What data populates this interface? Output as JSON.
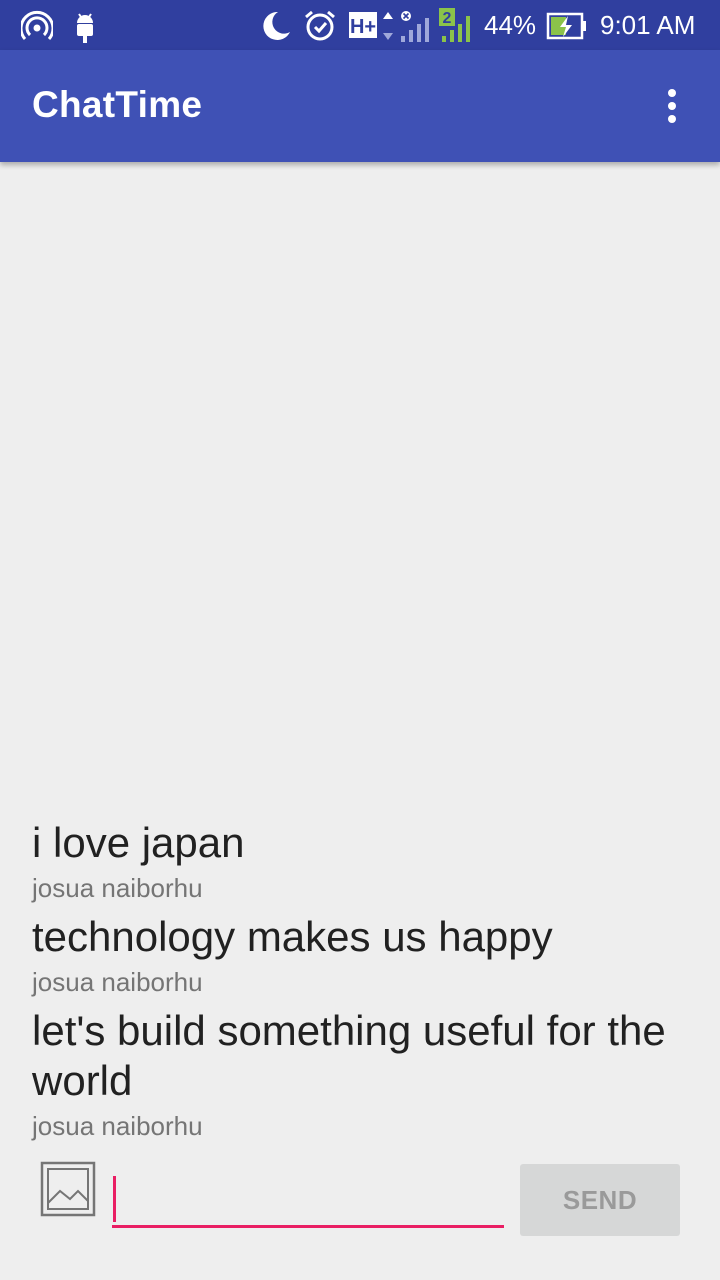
{
  "status_bar": {
    "icons": [
      "hotspot-icon",
      "android-debug-icon",
      "do-not-disturb-moon-icon",
      "alarm-icon",
      "network-h-plus-icon",
      "signal-icon",
      "sim-2-signal-icon",
      "battery-charging-icon"
    ],
    "network_type": "H+",
    "sim_label": "2",
    "battery_percent": "44%",
    "time": "9:01 AM",
    "colors": {
      "background": "#303f9f",
      "sim2": "#8bc34a",
      "battery_fill": "#8bc34a"
    }
  },
  "app_bar": {
    "title": "ChatTime",
    "menu_icon": "more-vert-icon",
    "color": "#3f51b5"
  },
  "messages": [
    {
      "text": "i love japan",
      "author": "josua naiborhu"
    },
    {
      "text": "technology makes us happy",
      "author": "josua naiborhu"
    },
    {
      "text": "let's build something useful for the world",
      "author": "josua naiborhu"
    }
  ],
  "composer": {
    "image_icon": "image-picker-icon",
    "input_value": "",
    "send_label": "SEND",
    "accent": "#e91e63"
  }
}
